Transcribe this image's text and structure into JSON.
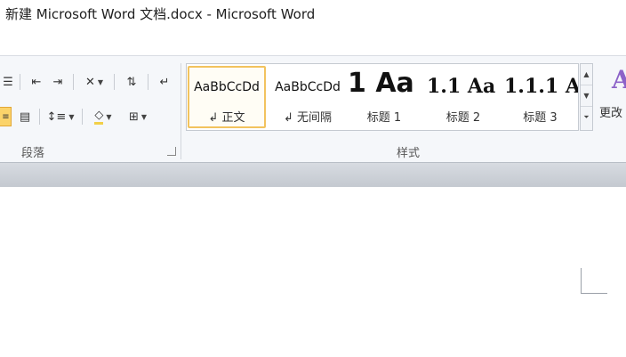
{
  "window": {
    "title": "新建 Microsoft Word 文档.docx  -  Microsoft Word"
  },
  "ribbon": {
    "paragraph_group": {
      "label": "段落",
      "buttons": [
        {
          "name": "bullets-list",
          "icon": "bullets-list-icon"
        },
        {
          "name": "decrease-indent",
          "icon": "decrease-indent-icon"
        },
        {
          "name": "increase-indent",
          "icon": "increase-indent-icon"
        },
        {
          "name": "chinese-layout",
          "icon": "chinese-layout-icon"
        },
        {
          "name": "sort",
          "icon": "sort-icon"
        },
        {
          "name": "show-hide-marks",
          "icon": "paragraph-mark-icon"
        },
        {
          "name": "distributed-align",
          "icon": "distributed-align-icon",
          "active": true
        },
        {
          "name": "line-spacing",
          "icon": "line-spacing-icon"
        },
        {
          "name": "shading",
          "icon": "shading-bucket-icon"
        },
        {
          "name": "borders",
          "icon": "borders-icon"
        }
      ]
    },
    "styles_group": {
      "label": "样式",
      "styles": [
        {
          "preview": "AaBbCcDd",
          "name": "↲ 正文",
          "selected": true
        },
        {
          "preview": "AaBbCcDd",
          "name": "↲ 无间隔",
          "selected": false
        },
        {
          "preview": "1",
          "name": "",
          "selected": false
        },
        {
          "preview": "Aa",
          "name": "标题 1",
          "selected": false
        },
        {
          "preview": "1.1",
          "name": "",
          "selected": false
        },
        {
          "preview": "Aa",
          "name": "标题 2",
          "selected": false
        },
        {
          "preview": "1.1.1",
          "name": "",
          "selected": false
        },
        {
          "preview": "A",
          "name": "标题 3",
          "selected": false
        }
      ],
      "tiles": [
        {
          "preview": "AaBbCcDd",
          "name": "↲ 正文"
        },
        {
          "preview": "AaBbCcDd",
          "name": "↲ 无间隔"
        },
        {
          "preview": "1 Aa",
          "name": "标题 1"
        },
        {
          "preview": "1.1 Aa",
          "name": "标题 2"
        },
        {
          "preview": "1.1.1 A",
          "name": "标题 3"
        }
      ]
    },
    "change_styles": {
      "label": "更改",
      "icon": "change-styles-icon"
    }
  },
  "colors": {
    "selected_style_border": "#f2c35e",
    "active_button": "#fbd36a",
    "change_styles_accent": "#8c62c8"
  }
}
